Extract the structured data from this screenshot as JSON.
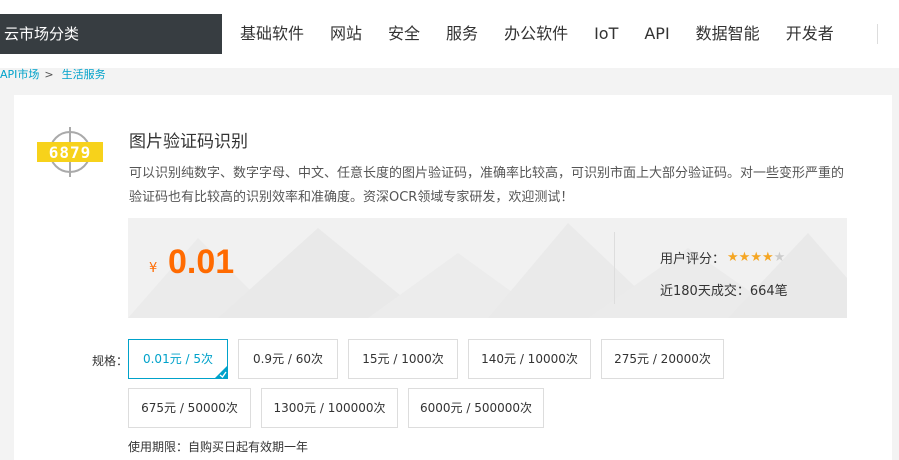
{
  "topbar": {
    "category_label": "云市场分类",
    "nav": [
      "基础软件",
      "网站",
      "安全",
      "服务",
      "办公软件",
      "IoT",
      "API",
      "数据智能",
      "开发者"
    ]
  },
  "breadcrumb": {
    "root": "API市场",
    "separator": ">",
    "current": "生活服务"
  },
  "product": {
    "title": "图片验证码识别",
    "description": "可以识别纯数字、数字字母、中文、任意长度的图片验证码，准确率比较高，可识别市面上大部分验证码。对一些变形严重的验证码也有比较高的识别效率和准确度。资深OCR领域专家研发，欢迎测试！",
    "logo_text": "6879",
    "price_currency": "¥",
    "price_value": "0.01",
    "rating_label": "用户评分：",
    "rating": 4,
    "rating_max": 5,
    "sales_text": "近180天成交：664笔"
  },
  "specs": {
    "label": "规格：",
    "options": [
      {
        "label": "0.01元 / 5次",
        "selected": true
      },
      {
        "label": "0.9元 / 60次",
        "selected": false
      },
      {
        "label": "15元 / 1000次",
        "selected": false
      },
      {
        "label": "140元 / 10000次",
        "selected": false
      },
      {
        "label": "275元 / 20000次",
        "selected": false
      },
      {
        "label": "675元 / 50000次",
        "selected": false
      },
      {
        "label": "1300元 / 100000次",
        "selected": false
      },
      {
        "label": "6000元 / 500000次",
        "selected": false
      }
    ]
  },
  "validity": "使用期限：自购买日起有效期一年",
  "colors": {
    "accent": "#00a2ca",
    "price": "#ff6a00",
    "star": "#f5a623",
    "topbar_dark": "#373d41"
  }
}
